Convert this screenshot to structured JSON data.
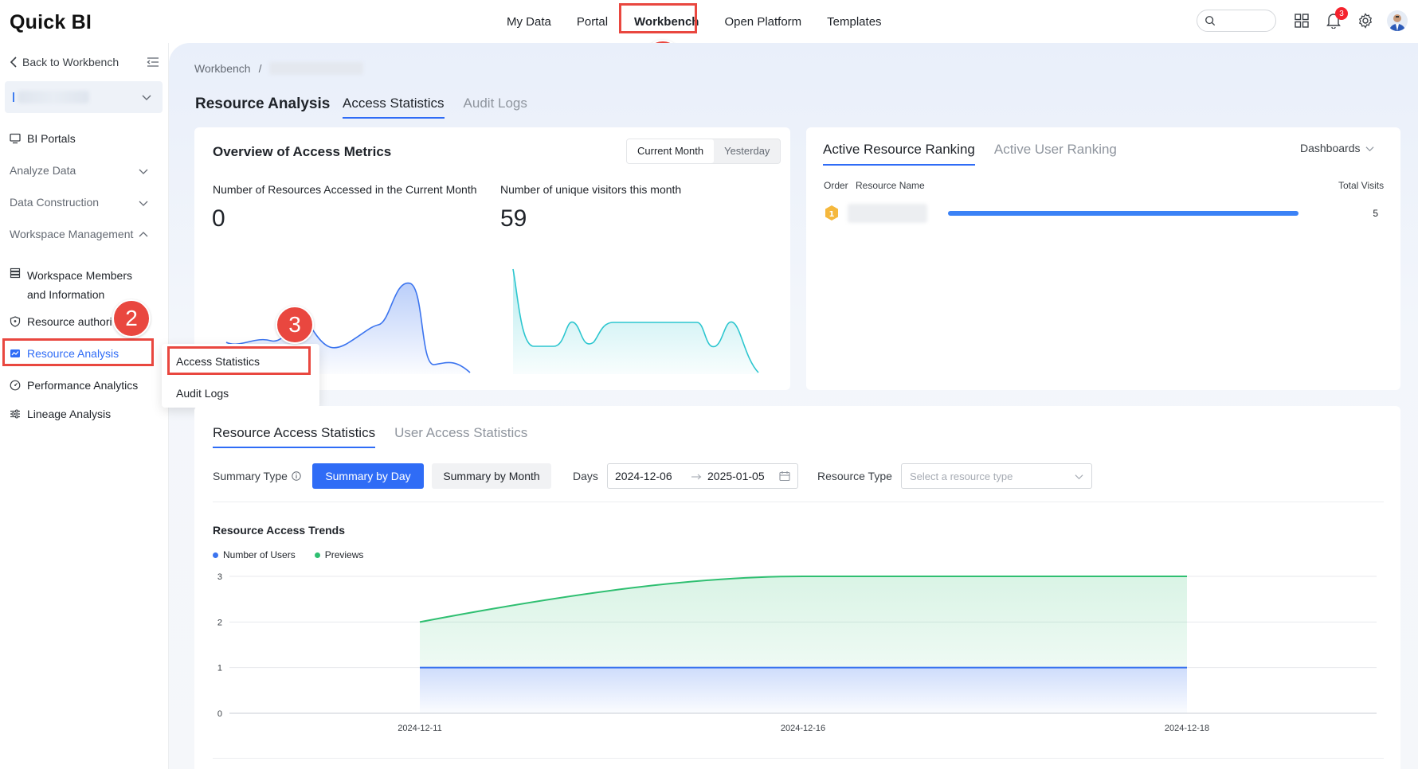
{
  "app": {
    "logo": "Quick BI"
  },
  "topnav": {
    "items": [
      "My Data",
      "Portal",
      "Workbench",
      "Open Platform",
      "Templates"
    ],
    "active": "Workbench",
    "notifications_count": "3"
  },
  "callouts": [
    "1",
    "2",
    "3"
  ],
  "sidebar": {
    "back_label": "Back to Workbench",
    "bi_portals": "BI Portals",
    "analyze_data": "Analyze Data",
    "data_construction": "Data Construction",
    "workspace_management": "Workspace Management",
    "workspace_members_line1": "Workspace Members",
    "workspace_members_line2": "and Information",
    "resource_authorization": "Resource authori",
    "resource_analysis": "Resource Analysis",
    "performance_analytics": "Performance Analytics",
    "lineage_analysis": "Lineage Analysis"
  },
  "flyout": {
    "items": [
      "Access Statistics",
      "Audit Logs"
    ]
  },
  "breadcrumb": {
    "root": "Workbench",
    "sep": "/"
  },
  "page": {
    "title": "Resource Analysis",
    "tabs": [
      "Access Statistics",
      "Audit Logs"
    ],
    "active_tab": "Access Statistics"
  },
  "overview": {
    "title": "Overview of Access Metrics",
    "segments": [
      "Current Month",
      "Yesterday"
    ],
    "active_segment": "Current Month",
    "metric1_label": "Number of Resources Accessed in the Current Month",
    "metric1_value": "0",
    "metric2_label": "Number of unique visitors this month",
    "metric2_value": "59"
  },
  "ranking": {
    "tabs": [
      "Active Resource Ranking",
      "Active User Ranking"
    ],
    "active_tab": "Active Resource Ranking",
    "dropdown": "Dashboards",
    "headers": {
      "order": "Order",
      "name": "Resource Name",
      "visits": "Total Visits"
    },
    "rows": [
      {
        "rank": "1",
        "visits": "5",
        "share": 1.0
      }
    ]
  },
  "stats": {
    "tabs": [
      "Resource Access Statistics",
      "User Access Statistics"
    ],
    "active_tab": "Resource Access Statistics",
    "summary_type_label": "Summary Type",
    "summary_by_day": "Summary by Day",
    "summary_by_month": "Summary by Month",
    "days_label": "Days",
    "date_start": "2024-12-06",
    "date_end": "2025-01-05",
    "resource_type_label": "Resource Type",
    "resource_type_placeholder": "Select a resource type"
  },
  "chart_data": {
    "type": "area",
    "title": "Resource Access Trends",
    "x": [
      "2024-12-11",
      "2024-12-16",
      "2024-12-18"
    ],
    "ylim": [
      0,
      3
    ],
    "yticks": [
      "3",
      "2",
      "1",
      "0"
    ],
    "legend_position": "top-left",
    "grid": true,
    "series": [
      {
        "name": "Number of Users",
        "values": [
          1,
          1,
          1
        ],
        "color": "#3b74ef"
      },
      {
        "name": "Previews",
        "values": [
          2,
          3,
          3
        ],
        "color": "#2fbf71"
      }
    ]
  },
  "colors": {
    "accent": "#2f6cf6",
    "callout": "#e9473f"
  }
}
